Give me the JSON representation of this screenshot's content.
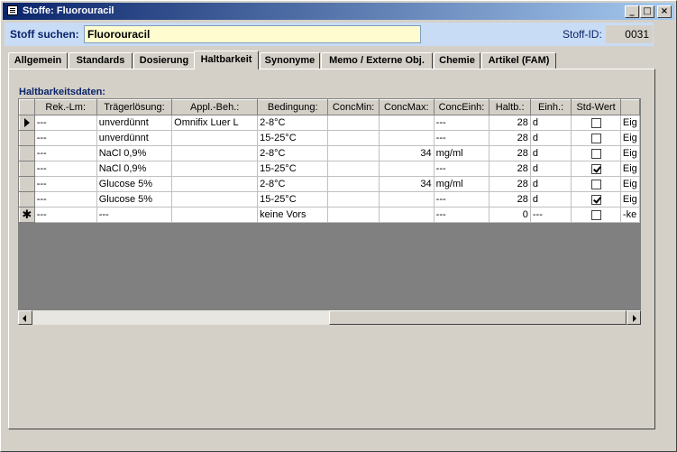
{
  "window": {
    "title": "Stoffe: Fluorouracil",
    "minimize": "_",
    "maximize": "□",
    "close": "×"
  },
  "search": {
    "label": "Stoff suchen:",
    "value": "Fluorouracil",
    "id_label": "Stoff-ID:",
    "id_value": "0031"
  },
  "tabs": [
    "Allgemein",
    "Standards",
    "Dosierung",
    "Haltbarkeit",
    "Synonyme",
    "Memo / Externe Obj.",
    "Chemie",
    "Artikel (FAM)"
  ],
  "active_tab": "Haltbarkeit",
  "section_title": "Haltbarkeitsdaten:",
  "table": {
    "columns": [
      "Rek.-Lm:",
      "Trägerlösung:",
      "Appl.-Beh.:",
      "Bedingung:",
      "ConcMin:",
      "ConcMax:",
      "ConcEinh:",
      "Haltb.:",
      "Einh.:",
      "Std-Wert",
      ""
    ],
    "rows": [
      {
        "marker": "current",
        "cells": [
          "---",
          "unverdünnt",
          "Omnifix Luer L",
          "2-8°C",
          "",
          "",
          "---",
          "28",
          "d",
          false,
          "Eig"
        ]
      },
      {
        "marker": "",
        "cells": [
          "---",
          "unverdünnt",
          "",
          "15-25°C",
          "",
          "",
          "---",
          "28",
          "d",
          false,
          "Eig"
        ]
      },
      {
        "marker": "",
        "cells": [
          "---",
          "NaCl 0,9%",
          "",
          "2-8°C",
          "",
          "34",
          "mg/ml",
          "28",
          "d",
          false,
          "Eig"
        ]
      },
      {
        "marker": "",
        "cells": [
          "---",
          "NaCl 0,9%",
          "",
          "15-25°C",
          "",
          "",
          "---",
          "28",
          "d",
          true,
          "Eig"
        ]
      },
      {
        "marker": "",
        "cells": [
          "---",
          "Glucose 5%",
          "",
          "2-8°C",
          "",
          "34",
          "mg/ml",
          "28",
          "d",
          false,
          "Eig"
        ]
      },
      {
        "marker": "",
        "cells": [
          "---",
          "Glucose 5%",
          "",
          "15-25°C",
          "",
          "",
          "---",
          "28",
          "d",
          true,
          "Eig"
        ]
      },
      {
        "marker": "new",
        "cells": [
          "---",
          "---",
          "",
          "keine Vors",
          "",
          "",
          "---",
          "0",
          "---",
          false,
          "-ke"
        ]
      }
    ]
  },
  "colors": {
    "title_start": "#0a246a",
    "title_end": "#a6caf0",
    "search_band": "#c9dcf5",
    "search_input_bg": "#fffdd0",
    "label_color": "#0a246a"
  }
}
